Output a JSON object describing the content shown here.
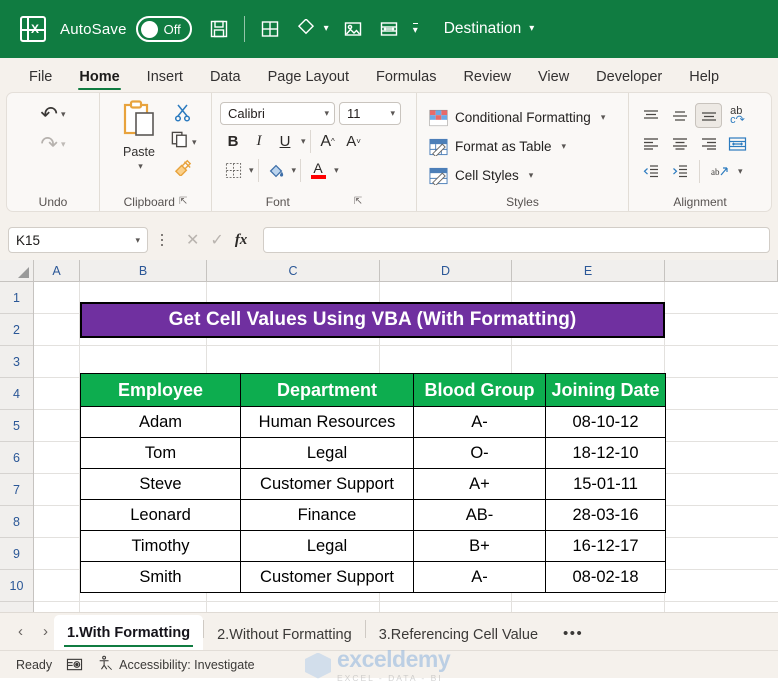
{
  "titlebar": {
    "app_icon": "excel-logo-icon",
    "autosave_label": "AutoSave",
    "autosave_state": "Off",
    "save_icon": "save-icon",
    "qat_icons": [
      "table-icon",
      "shapes-icon",
      "picture-icon",
      "merge-cells-icon"
    ],
    "qat_more": "customize-quick-access-toolbar-icon",
    "file_name": "Destination",
    "brand_color": "#107C41"
  },
  "ribbon_tabs": [
    {
      "label": "File",
      "active": false
    },
    {
      "label": "Home",
      "active": true
    },
    {
      "label": "Insert",
      "active": false
    },
    {
      "label": "Data",
      "active": false
    },
    {
      "label": "Page Layout",
      "active": false
    },
    {
      "label": "Formulas",
      "active": false
    },
    {
      "label": "Review",
      "active": false
    },
    {
      "label": "View",
      "active": false
    },
    {
      "label": "Developer",
      "active": false
    },
    {
      "label": "Help",
      "active": false
    }
  ],
  "ribbon": {
    "undo": {
      "label": "Undo",
      "undo_icon": "undo-arrow-icon",
      "redo_icon": "redo-arrow-icon"
    },
    "clipboard": {
      "label": "Clipboard",
      "paste_label": "Paste",
      "cut_icon": "scissors-icon",
      "copy_icon": "copy-icon",
      "format_painter_icon": "format-painter-icon",
      "dialog_launcher": "dialog-launcher-icon"
    },
    "font": {
      "label": "Font",
      "font_name": "Calibri",
      "font_size": "11",
      "bold": "B",
      "italic": "I",
      "underline": "U",
      "grow_font": "A",
      "shrink_font": "A",
      "borders_icon": "borders-icon",
      "fill_color_icon": "fill-color-icon",
      "font_color_icon": "font-color-icon",
      "font_color": "#FF0000",
      "dialog_launcher": "dialog-launcher-icon"
    },
    "styles": {
      "label": "Styles",
      "items": [
        {
          "label": "Conditional Formatting",
          "icon": "conditional-formatting-icon"
        },
        {
          "label": "Format as Table",
          "icon": "format-as-table-icon"
        },
        {
          "label": "Cell Styles",
          "icon": "cell-styles-icon"
        }
      ]
    },
    "alignment": {
      "label": "Alignment",
      "top_align": "align-top-icon",
      "middle_align": "align-middle-icon",
      "bottom_align": "align-bottom-icon",
      "wrap_text": "wrap-text-icon",
      "align_left": "align-left-icon",
      "align_center": "align-center-icon",
      "align_right": "align-right-icon",
      "merge_center": "merge-and-center-icon",
      "decrease_indent": "decrease-indent-icon",
      "increase_indent": "increase-indent-icon",
      "orientation": "orientation-icon"
    }
  },
  "formula_bar": {
    "name_box_value": "K15",
    "cancel_icon": "cancel-icon",
    "enter_icon": "enter-check-icon",
    "function_icon": "insert-function-fx-icon",
    "formula_value": "",
    "formula_placeholder": ""
  },
  "grid": {
    "columns": [
      "A",
      "B",
      "C",
      "D",
      "E"
    ],
    "rows": [
      "1",
      "2",
      "3",
      "4",
      "5",
      "6",
      "7",
      "8",
      "9",
      "10"
    ]
  },
  "sheet": {
    "banner_title": "Get Cell Values Using VBA (With Formatting)",
    "banner_fill": "#7030A0",
    "header_fill": "#0DAD4F",
    "table": {
      "headers": [
        "Employee",
        "Department",
        "Blood Group",
        "Joining Date"
      ],
      "rows": [
        [
          "Adam",
          "Human Resources",
          "A-",
          "08-10-12"
        ],
        [
          "Tom",
          "Legal",
          "O-",
          "18-12-10"
        ],
        [
          "Steve",
          "Customer Support",
          "A+",
          "15-01-11"
        ],
        [
          "Leonard",
          "Finance",
          "AB-",
          "28-03-16"
        ],
        [
          "Timothy",
          "Legal",
          "B+",
          "16-12-17"
        ],
        [
          "Smith",
          "Customer Support",
          "A-",
          "08-02-18"
        ]
      ]
    }
  },
  "sheet_tabs": {
    "prev_icon": "previous-sheet-icon",
    "next_icon": "next-sheet-icon",
    "tabs": [
      {
        "label": "1.With Formatting",
        "active": true
      },
      {
        "label": "2.Without Formatting",
        "active": false
      },
      {
        "label": "3.Referencing Cell Value",
        "active": false
      }
    ],
    "more_label": "•••"
  },
  "statusbar": {
    "mode": "Ready",
    "macro_icon": "record-macro-icon",
    "accessibility_icon": "accessibility-icon",
    "accessibility_label": "Accessibility: Investigate"
  },
  "watermark": {
    "name": "exceldemy",
    "tagline": "EXCEL - DATA - BI"
  }
}
